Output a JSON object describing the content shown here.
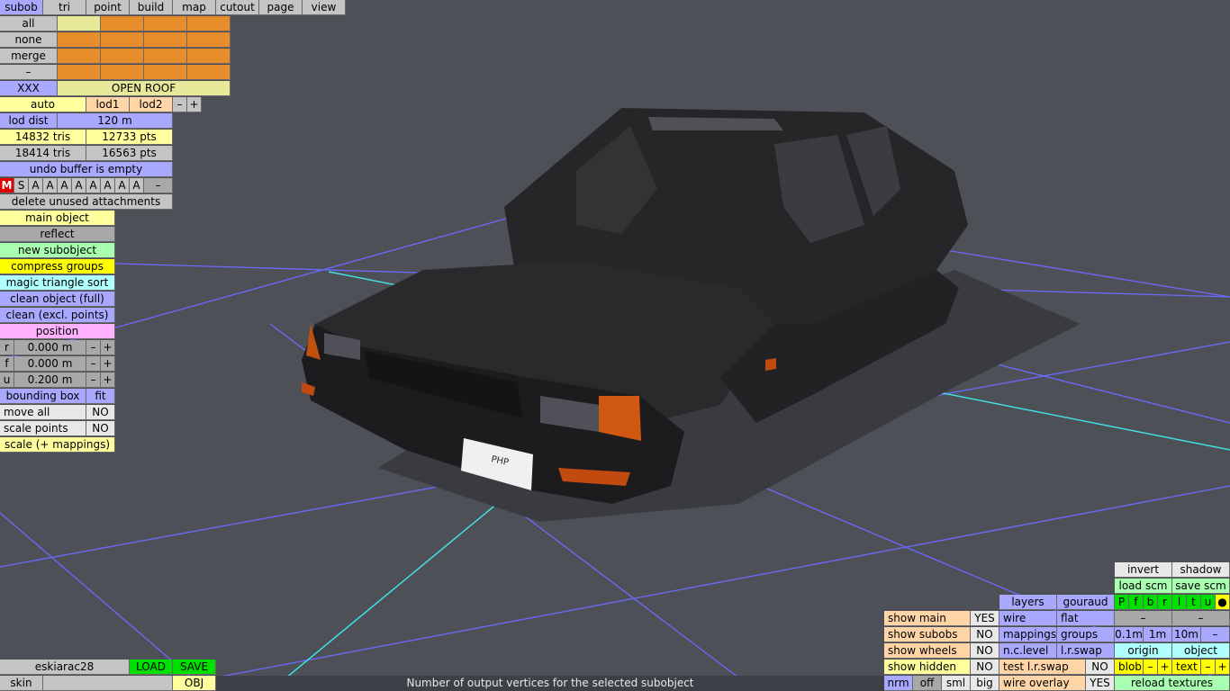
{
  "menu": [
    "subob",
    "tri",
    "point",
    "build",
    "map",
    "cutout",
    "page",
    "view"
  ],
  "left_panel": {
    "sel_all": "all",
    "sel_none": "none",
    "sel_merge": "merge",
    "sel_minus": "–",
    "xxx": "XXX",
    "open_roof": "OPEN ROOF",
    "auto": "auto",
    "lod1": "lod1",
    "lod2": "lod2",
    "lod_minus": "–",
    "lod_plus": "+",
    "lod_dist_label": "lod dist",
    "lod_dist_value": "120 m",
    "tris1": "14832 tris",
    "pts1": "12733 pts",
    "tris2": "18414 tris",
    "pts2": "16563 pts",
    "undo": "undo buffer is empty",
    "m_btn": "M",
    "s_btn": "S",
    "a_btns": [
      "A",
      "A",
      "A",
      "A",
      "A",
      "A",
      "A",
      "A"
    ],
    "a_minus": "–",
    "delete_unused": "delete unused attachments",
    "main_object": "main object",
    "reflect": "reflect",
    "new_subobject": "new subobject",
    "compress_groups": "compress groups",
    "magic_sort": "magic triangle sort",
    "clean_full": "clean object (full)",
    "clean_excl": "clean (excl. points)",
    "position": "position",
    "pos_rows": [
      {
        "axis": "r",
        "value": "0.000 m"
      },
      {
        "axis": "f",
        "value": "0.000 m"
      },
      {
        "axis": "u",
        "value": "0.200 m"
      }
    ],
    "pm_minus": "–",
    "pm_plus": "+",
    "bounding_box": "bounding box",
    "fit": "fit",
    "move_all": "move all",
    "move_all_val": "NO",
    "scale_points": "scale points",
    "scale_points_val": "NO",
    "scale_mappings": "scale (+ mappings)"
  },
  "bottom_left": {
    "name": "eskiarac28",
    "load": "LOAD",
    "save": "SAVE",
    "skin": "skin",
    "obj": "OBJ"
  },
  "status_text": "Number of output vertices for the selected subobject",
  "right_panel": {
    "invert": "invert",
    "shadow": "shadow",
    "load_scm": "load scm",
    "save_scm": "save scm",
    "flags": [
      "P",
      "f",
      "b",
      "r",
      "l",
      "t",
      "u",
      "●"
    ],
    "layers": "layers",
    "gouraud": "gouraud",
    "show_main": "show main",
    "show_main_val": "YES",
    "wire": "wire",
    "flat": "flat",
    "minus": "–",
    "show_subobs": "show subobs",
    "show_subobs_val": "NO",
    "mappings": "mappings",
    "groups": "groups",
    "d01": "0.1m",
    "d1": "1m",
    "d10": "10m",
    "show_wheels": "show wheels",
    "show_wheels_val": "NO",
    "nc_level": "n.c.level",
    "lr_swap": "l.r.swap",
    "origin": "origin",
    "object": "object",
    "show_hidden": "show hidden",
    "show_hidden_val": "NO",
    "test_lr_swap": "test l.r.swap",
    "test_lr_val": "NO",
    "blob": "blob",
    "text": "text",
    "plus": "+",
    "nrm": "nrm",
    "off": "off",
    "sml": "sml",
    "big": "big",
    "wire_overlay": "wire overlay",
    "wire_overlay_val": "YES",
    "reload_textures": "reload textures"
  },
  "plate_text": "PHP",
  "colors": {
    "background": "#4e5058",
    "grid": "#6a6aff",
    "axis": "#40e0e0",
    "car_body": "#262628"
  }
}
